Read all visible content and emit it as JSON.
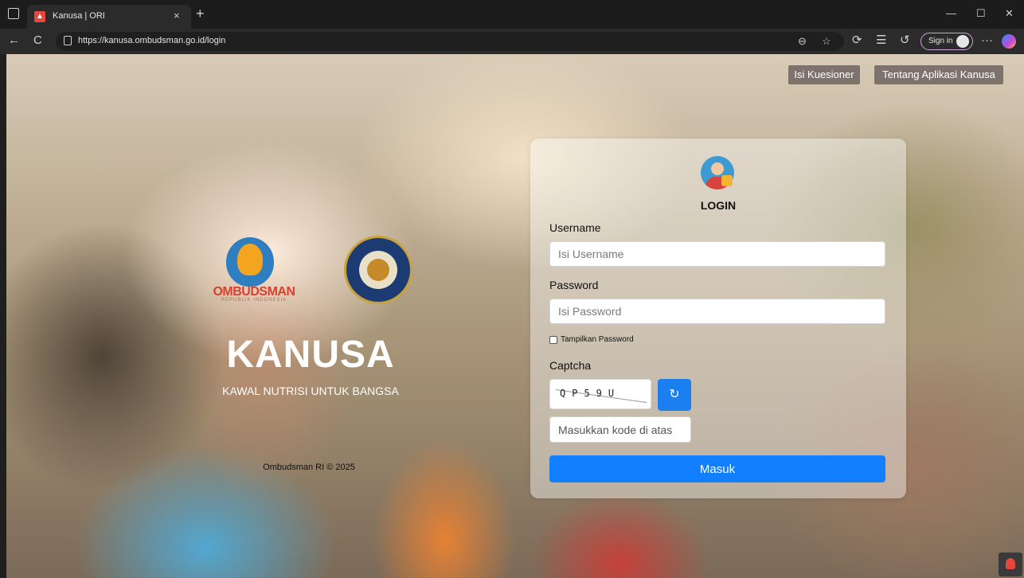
{
  "browser": {
    "tab_title": "Kanusa | ORI",
    "tab_close": "×",
    "new_tab": "+",
    "url": "https://kanusa.ombudsman.go.id/login",
    "signin_label": "Sign in",
    "more": "···",
    "back": "←",
    "refresh": "C",
    "minimize": "—",
    "maximize": "☐",
    "close": "✕"
  },
  "header": {
    "kuesioner_label": "Isi Kuesioner",
    "tentang_label": "Tentang Aplikasi Kanusa"
  },
  "branding": {
    "ombudsman_word": "OMBUDSMAN",
    "ombudsman_sub": "REPUBLIK INDONESIA",
    "app_title": "KANUSA",
    "app_subtitle": "KAWAL NUTRISI UNTUK BANGSA",
    "footer": "Ombudsman RI © 2025"
  },
  "login": {
    "title": "LOGIN",
    "username_label": "Username",
    "username_placeholder": "Isi Username",
    "password_label": "Password",
    "password_placeholder": "Isi Password",
    "show_password_label": "Tampilkan Password",
    "captcha_label": "Captcha",
    "captcha_text": "QP59U",
    "refresh_icon": "↻",
    "captcha_placeholder": "Masukkan kode di atas",
    "submit_label": "Masuk"
  },
  "colors": {
    "primary": "#117fff",
    "header_button_bg": "#6e645f"
  }
}
